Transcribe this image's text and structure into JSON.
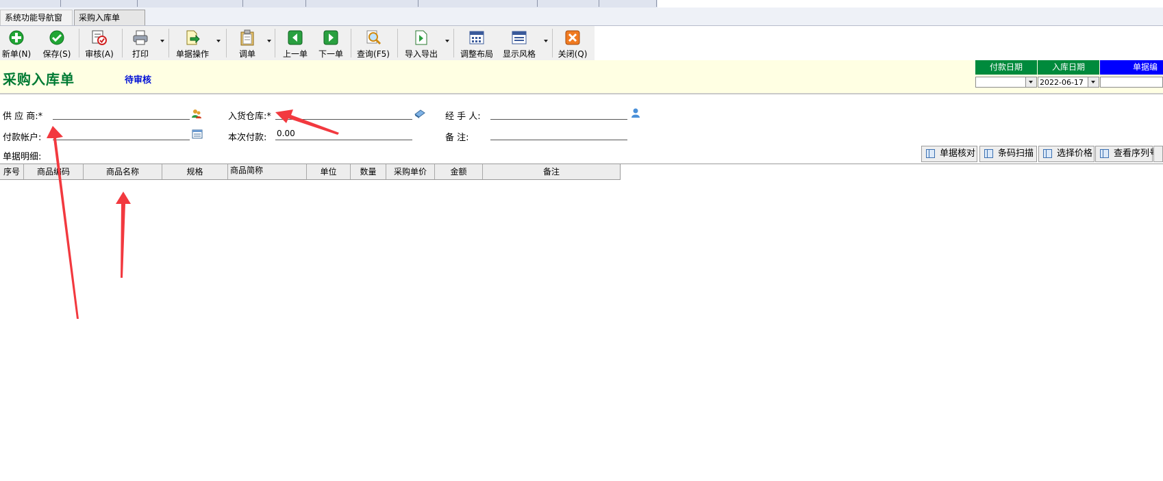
{
  "tabs": [
    {
      "label": "系统功能导航窗",
      "active": false
    },
    {
      "label": "采购入库单",
      "active": true
    }
  ],
  "toolbar": {
    "buttons": [
      {
        "label": "新单(N)",
        "icon": "plus-circle-icon"
      },
      {
        "label": "保存(S)",
        "icon": "check-circle-icon"
      },
      {
        "label": "审核(A)",
        "icon": "approve-stamp-icon"
      },
      {
        "label": "打印",
        "icon": "printer-icon",
        "dropdown": true
      },
      {
        "label": "单据操作",
        "icon": "document-arrow-icon",
        "dropdown": true
      },
      {
        "label": "调单",
        "icon": "clipboard-icon",
        "dropdown": true
      },
      {
        "label": "上一单",
        "icon": "arrow-left-icon"
      },
      {
        "label": "下一单",
        "icon": "arrow-right-icon"
      },
      {
        "label": "查询(F5)",
        "icon": "magnifier-icon"
      },
      {
        "label": "导入导出",
        "icon": "import-export-icon",
        "dropdown": true
      },
      {
        "label": "调整布局",
        "icon": "layout-grid-icon"
      },
      {
        "label": "显示风格",
        "icon": "display-style-icon",
        "dropdown": true
      },
      {
        "label": "关闭(Q)",
        "icon": "close-x-icon"
      }
    ]
  },
  "header": {
    "title": "采购入库单",
    "status": "待审核",
    "columns": [
      {
        "label": "付款日期",
        "value": ""
      },
      {
        "label": "入库日期",
        "value": "2022-06-17"
      },
      {
        "label": "单据编号",
        "value": ""
      }
    ],
    "colors": {
      "title": "#007a33",
      "status": "#0010d6",
      "header_green": "#008a3c",
      "header_blue": "#0000ff",
      "banner_bg": "#ffffe3"
    }
  },
  "form": {
    "supplier_label": "供 应 商:",
    "supplier_value": "",
    "warehouse_label": "入货仓库:",
    "warehouse_value": "",
    "handler_label": "经 手 人:",
    "handler_value": "",
    "account_label": "付款帐户:",
    "account_value": "",
    "payment_label": "本次付款:",
    "payment_value": "0.00",
    "remark_label": "备    注:",
    "remark_value": "",
    "required_mark": "*"
  },
  "detail": {
    "label": "单据明细:",
    "buttons": [
      "单据核对",
      "条码扫描",
      "选择价格",
      "查看序列号"
    ]
  },
  "grid": {
    "columns": [
      "序号",
      "商品编码",
      "商品名称",
      "规格",
      "商品简称",
      "单位",
      "数量",
      "采购单价",
      "金额",
      "备注"
    ]
  }
}
